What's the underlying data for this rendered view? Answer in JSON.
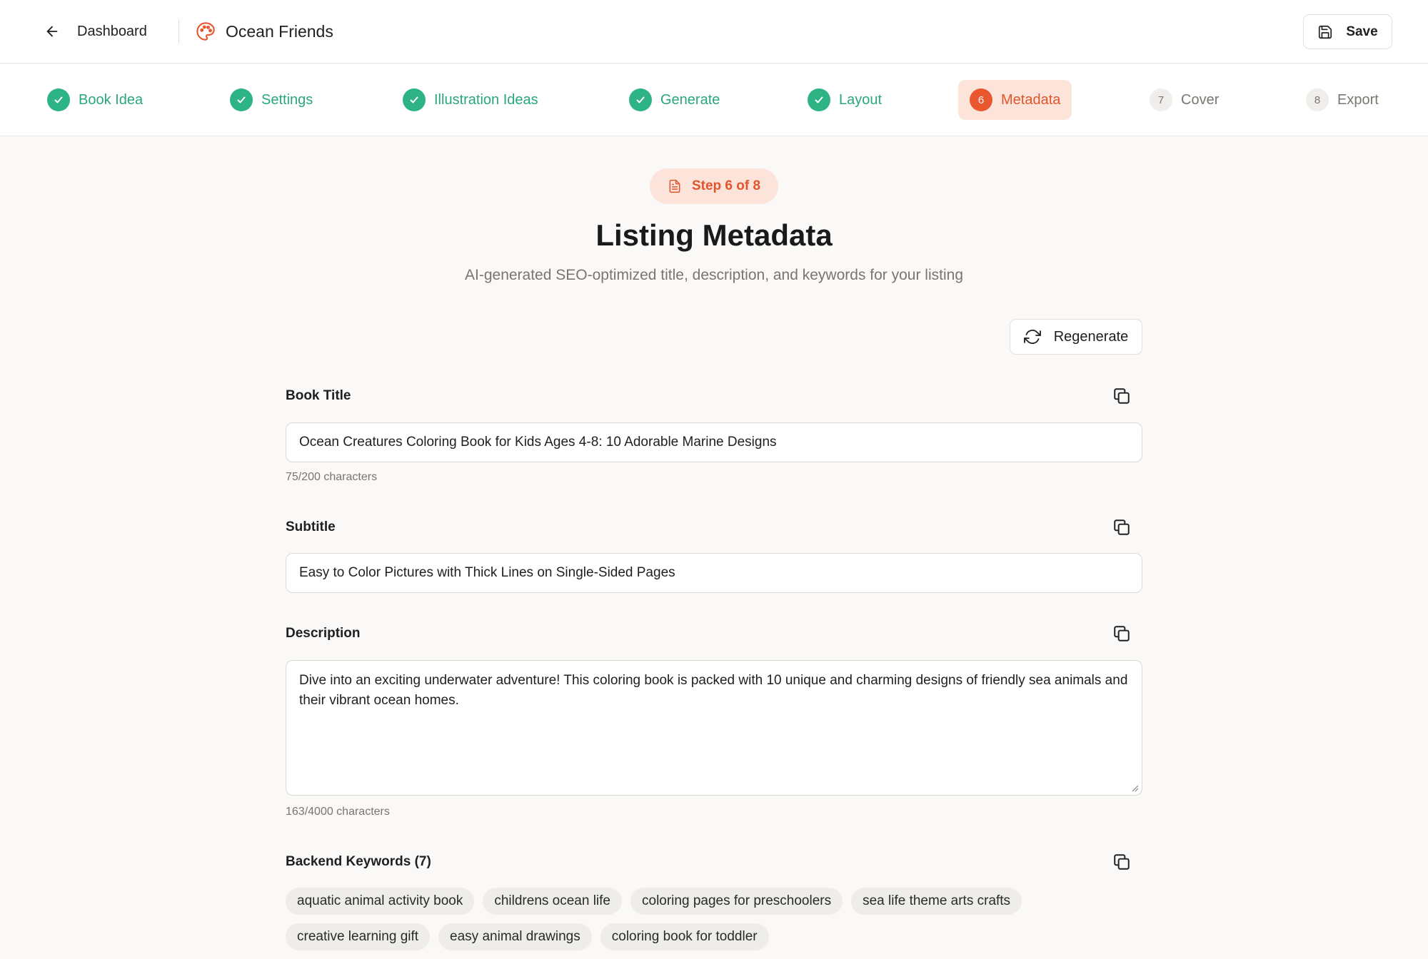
{
  "header": {
    "back_label": "Dashboard",
    "project_title": "Ocean Friends",
    "save_label": "Save"
  },
  "stepper": {
    "steps": [
      {
        "number": "1",
        "label": "Book Idea",
        "state": "done"
      },
      {
        "number": "2",
        "label": "Settings",
        "state": "done"
      },
      {
        "number": "3",
        "label": "Illustration Ideas",
        "state": "done"
      },
      {
        "number": "4",
        "label": "Generate",
        "state": "done"
      },
      {
        "number": "5",
        "label": "Layout",
        "state": "done"
      },
      {
        "number": "6",
        "label": "Metadata",
        "state": "active"
      },
      {
        "number": "7",
        "label": "Cover",
        "state": "todo"
      },
      {
        "number": "8",
        "label": "Export",
        "state": "todo"
      }
    ]
  },
  "main": {
    "step_badge": "Step 6 of 8",
    "title": "Listing Metadata",
    "subtitle": "AI-generated SEO-optimized title, description, and keywords for your listing",
    "regenerate_label": "Regenerate",
    "book_title": {
      "label": "Book Title",
      "value": "Ocean Creatures Coloring Book for Kids Ages 4-8: 10 Adorable Marine Designs",
      "char_count": "75/200 characters"
    },
    "subtitle_field": {
      "label": "Subtitle",
      "value": "Easy to Color Pictures with Thick Lines on Single-Sided Pages"
    },
    "description": {
      "label": "Description",
      "value": "Dive into an exciting underwater adventure! This coloring book is packed with 10 unique and charming designs of friendly sea animals and their vibrant ocean homes.",
      "char_count": "163/4000 characters"
    },
    "keywords": {
      "label": "Backend Keywords (7)",
      "items": [
        "aquatic animal activity book",
        "childrens ocean life",
        "coloring pages for preschoolers",
        "sea life theme arts crafts",
        "creative learning gift",
        "easy animal drawings",
        "coloring book for toddler"
      ]
    }
  },
  "colors": {
    "accent": "#e8572e",
    "accent_bg": "#fde4da",
    "success": "#2eb384",
    "background": "#faf9f7"
  },
  "icons": {
    "back": "arrow-left-icon",
    "brand": "palette-icon",
    "save": "floppy-disk-icon",
    "check": "check-icon",
    "step_badge": "document-icon",
    "regenerate": "refresh-icon",
    "copy": "copy-icon"
  }
}
